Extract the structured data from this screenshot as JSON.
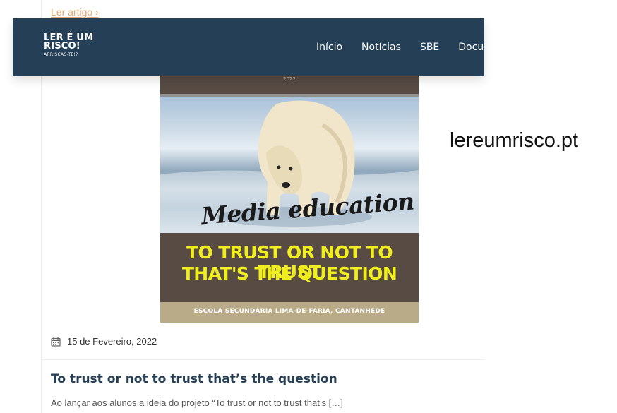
{
  "article": {
    "read_more": "Ler artigo ›",
    "date": "15 de Fevereiro, 2022",
    "title": "To trust or not to trust that’s the question",
    "excerpt": "Ao lançar aos alunos a ideia do projeto “To trust or not to trust that’s […]"
  },
  "header": {
    "logo_line1": "LER É UM",
    "logo_line2": "RISCO!",
    "logo_tagline": "ARRISCAS-TE!?",
    "nav": [
      "Início",
      "Notícias",
      "SBE",
      "Docu"
    ]
  },
  "poster": {
    "year": "2022",
    "script_title": "Media education",
    "headline_line1": "TO TRUST OR NOT TO TRUST",
    "headline_line2": "THAT'S THE QUESTION",
    "school": "ESCOLA SECUNDÁRIA LIMA-DE-FARIA, CANTANHEDE"
  },
  "source_label": "lereumrisco.pt",
  "icons": {
    "date": "calendar-icon"
  },
  "colors": {
    "navbar": "#253f56",
    "accent_link": "#e3a877",
    "title": "#253f56",
    "poster_brown": "#574b44",
    "poster_yellow": "#f0ee1e",
    "poster_tan": "#b9ab88"
  }
}
